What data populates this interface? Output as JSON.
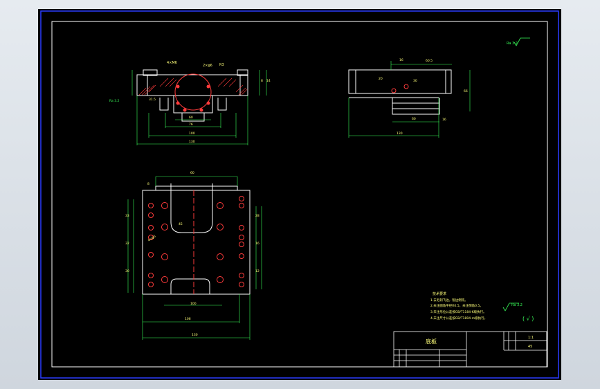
{
  "drawing": {
    "roughness_top_right": "Ra 3.2",
    "roughness_bottom": "Ra 3.2",
    "roughness_left": "Ra 3.2",
    "roughness_bracket": "( √ )",
    "tech_requirements_title": "技术要求",
    "tech_requirements": [
      "1.去毛刺飞边，锐边倒钝。",
      "2.未注圆角半径R0.5，未注倒角0.5。",
      "3.未注形位公差按GB/T1184-K级执行。",
      "4.未注尺寸公差按GB/T1804-m级执行。"
    ],
    "title_block": {
      "part_name": "底板",
      "scale": "1:1",
      "material": "45"
    },
    "dims_front": [
      "4×M6",
      "2×φ6",
      "R3",
      "60",
      "76",
      "100",
      "130",
      "8",
      "14",
      "31.5",
      "Ra 3.2"
    ],
    "dims_side": [
      "16",
      "60.5",
      "20",
      "30",
      "60",
      "16",
      "130",
      "66"
    ],
    "dims_top": [
      "60",
      "8",
      "100",
      "106",
      "130",
      "45",
      "4×φ6",
      "33",
      "32",
      "30",
      "28",
      "16",
      "12"
    ]
  }
}
